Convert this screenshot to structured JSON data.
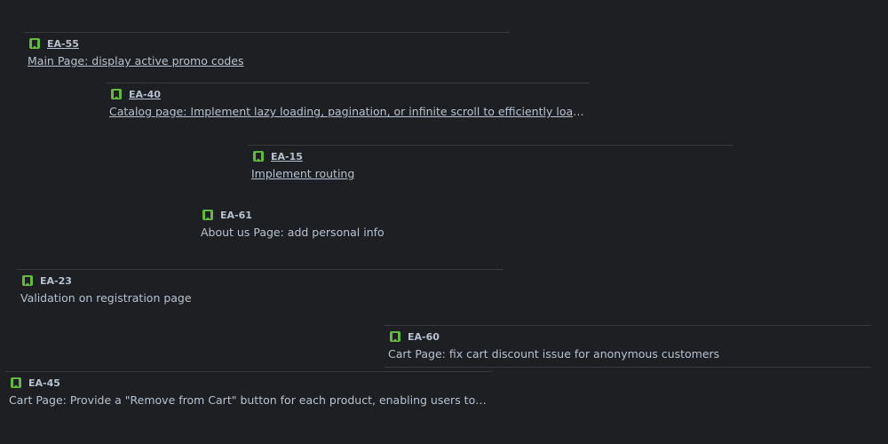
{
  "issues": [
    {
      "key": "EA-55",
      "summary": "Main Page: display active promo codes",
      "icon": "story-icon"
    },
    {
      "key": "EA-40",
      "summary": "Catalog page: Implement lazy loading, pagination, or infinite scroll to efficiently load and display products",
      "icon": "story-icon"
    },
    {
      "key": "EA-15",
      "summary": "Implement routing",
      "icon": "story-icon"
    },
    {
      "key": "EA-61",
      "summary": "About us Page: add personal info",
      "icon": "story-icon"
    },
    {
      "key": "EA-23",
      "summary": "Validation on registration page",
      "icon": "story-icon"
    },
    {
      "key": "EA-60",
      "summary": "Cart Page: fix cart discount issue for anonymous customers",
      "icon": "story-icon"
    },
    {
      "key": "EA-45",
      "summary": "Cart Page: Provide a \"Remove from Cart\" button for each product, enabling users to delete items",
      "icon": "story-icon"
    }
  ],
  "colors": {
    "background": "#1e1f22",
    "text": "#b6c2cf",
    "story_icon": "#63ba3c",
    "divider": "#3a3b3f"
  }
}
